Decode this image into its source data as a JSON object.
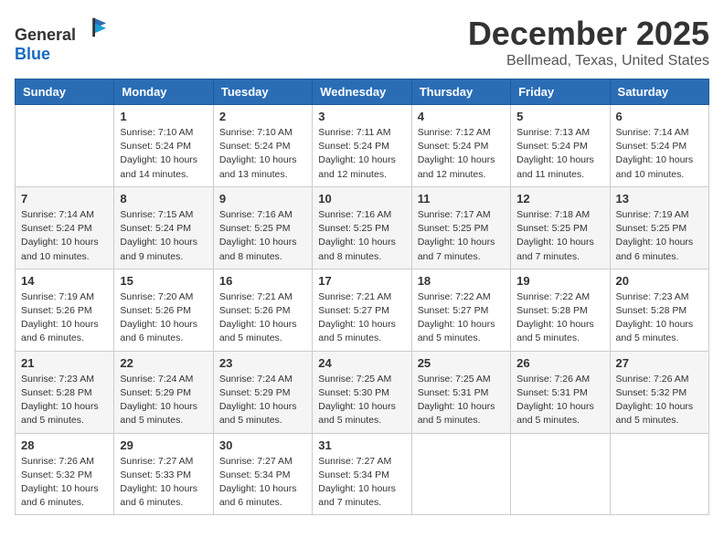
{
  "header": {
    "logo_general": "General",
    "logo_blue": "Blue",
    "month": "December 2025",
    "location": "Bellmead, Texas, United States"
  },
  "weekdays": [
    "Sunday",
    "Monday",
    "Tuesday",
    "Wednesday",
    "Thursday",
    "Friday",
    "Saturday"
  ],
  "weeks": [
    [
      {
        "day": "",
        "info": ""
      },
      {
        "day": "1",
        "info": "Sunrise: 7:10 AM\nSunset: 5:24 PM\nDaylight: 10 hours\nand 14 minutes."
      },
      {
        "day": "2",
        "info": "Sunrise: 7:10 AM\nSunset: 5:24 PM\nDaylight: 10 hours\nand 13 minutes."
      },
      {
        "day": "3",
        "info": "Sunrise: 7:11 AM\nSunset: 5:24 PM\nDaylight: 10 hours\nand 12 minutes."
      },
      {
        "day": "4",
        "info": "Sunrise: 7:12 AM\nSunset: 5:24 PM\nDaylight: 10 hours\nand 12 minutes."
      },
      {
        "day": "5",
        "info": "Sunrise: 7:13 AM\nSunset: 5:24 PM\nDaylight: 10 hours\nand 11 minutes."
      },
      {
        "day": "6",
        "info": "Sunrise: 7:14 AM\nSunset: 5:24 PM\nDaylight: 10 hours\nand 10 minutes."
      }
    ],
    [
      {
        "day": "7",
        "info": "Sunrise: 7:14 AM\nSunset: 5:24 PM\nDaylight: 10 hours\nand 10 minutes."
      },
      {
        "day": "8",
        "info": "Sunrise: 7:15 AM\nSunset: 5:24 PM\nDaylight: 10 hours\nand 9 minutes."
      },
      {
        "day": "9",
        "info": "Sunrise: 7:16 AM\nSunset: 5:25 PM\nDaylight: 10 hours\nand 8 minutes."
      },
      {
        "day": "10",
        "info": "Sunrise: 7:16 AM\nSunset: 5:25 PM\nDaylight: 10 hours\nand 8 minutes."
      },
      {
        "day": "11",
        "info": "Sunrise: 7:17 AM\nSunset: 5:25 PM\nDaylight: 10 hours\nand 7 minutes."
      },
      {
        "day": "12",
        "info": "Sunrise: 7:18 AM\nSunset: 5:25 PM\nDaylight: 10 hours\nand 7 minutes."
      },
      {
        "day": "13",
        "info": "Sunrise: 7:19 AM\nSunset: 5:25 PM\nDaylight: 10 hours\nand 6 minutes."
      }
    ],
    [
      {
        "day": "14",
        "info": "Sunrise: 7:19 AM\nSunset: 5:26 PM\nDaylight: 10 hours\nand 6 minutes."
      },
      {
        "day": "15",
        "info": "Sunrise: 7:20 AM\nSunset: 5:26 PM\nDaylight: 10 hours\nand 6 minutes."
      },
      {
        "day": "16",
        "info": "Sunrise: 7:21 AM\nSunset: 5:26 PM\nDaylight: 10 hours\nand 5 minutes."
      },
      {
        "day": "17",
        "info": "Sunrise: 7:21 AM\nSunset: 5:27 PM\nDaylight: 10 hours\nand 5 minutes."
      },
      {
        "day": "18",
        "info": "Sunrise: 7:22 AM\nSunset: 5:27 PM\nDaylight: 10 hours\nand 5 minutes."
      },
      {
        "day": "19",
        "info": "Sunrise: 7:22 AM\nSunset: 5:28 PM\nDaylight: 10 hours\nand 5 minutes."
      },
      {
        "day": "20",
        "info": "Sunrise: 7:23 AM\nSunset: 5:28 PM\nDaylight: 10 hours\nand 5 minutes."
      }
    ],
    [
      {
        "day": "21",
        "info": "Sunrise: 7:23 AM\nSunset: 5:28 PM\nDaylight: 10 hours\nand 5 minutes."
      },
      {
        "day": "22",
        "info": "Sunrise: 7:24 AM\nSunset: 5:29 PM\nDaylight: 10 hours\nand 5 minutes."
      },
      {
        "day": "23",
        "info": "Sunrise: 7:24 AM\nSunset: 5:29 PM\nDaylight: 10 hours\nand 5 minutes."
      },
      {
        "day": "24",
        "info": "Sunrise: 7:25 AM\nSunset: 5:30 PM\nDaylight: 10 hours\nand 5 minutes."
      },
      {
        "day": "25",
        "info": "Sunrise: 7:25 AM\nSunset: 5:31 PM\nDaylight: 10 hours\nand 5 minutes."
      },
      {
        "day": "26",
        "info": "Sunrise: 7:26 AM\nSunset: 5:31 PM\nDaylight: 10 hours\nand 5 minutes."
      },
      {
        "day": "27",
        "info": "Sunrise: 7:26 AM\nSunset: 5:32 PM\nDaylight: 10 hours\nand 5 minutes."
      }
    ],
    [
      {
        "day": "28",
        "info": "Sunrise: 7:26 AM\nSunset: 5:32 PM\nDaylight: 10 hours\nand 6 minutes."
      },
      {
        "day": "29",
        "info": "Sunrise: 7:27 AM\nSunset: 5:33 PM\nDaylight: 10 hours\nand 6 minutes."
      },
      {
        "day": "30",
        "info": "Sunrise: 7:27 AM\nSunset: 5:34 PM\nDaylight: 10 hours\nand 6 minutes."
      },
      {
        "day": "31",
        "info": "Sunrise: 7:27 AM\nSunset: 5:34 PM\nDaylight: 10 hours\nand 7 minutes."
      },
      {
        "day": "",
        "info": ""
      },
      {
        "day": "",
        "info": ""
      },
      {
        "day": "",
        "info": ""
      }
    ]
  ]
}
